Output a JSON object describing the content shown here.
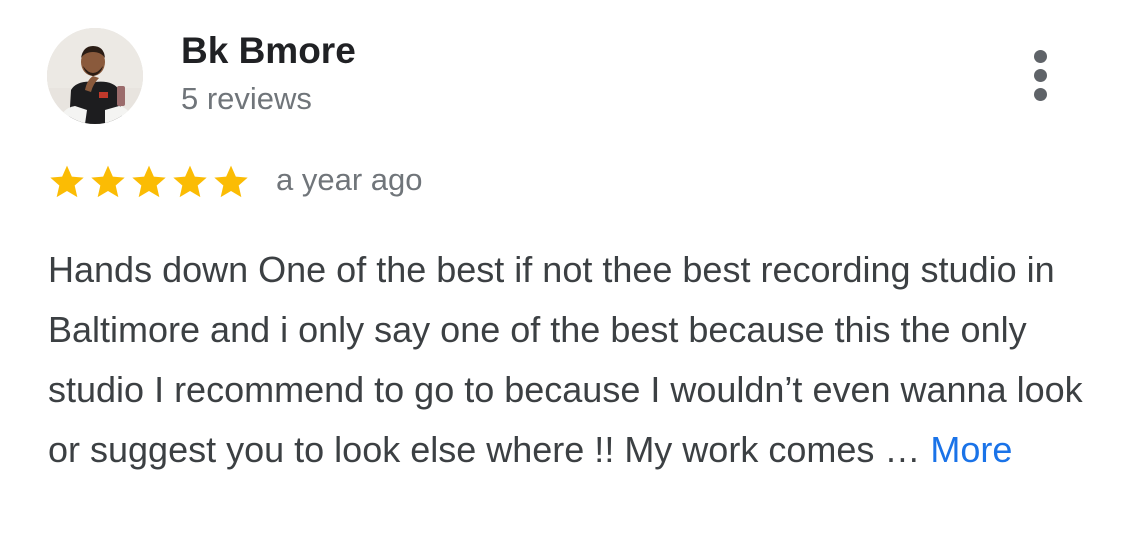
{
  "review": {
    "author": {
      "name": "Bk Bmore",
      "review_count": "5 reviews",
      "avatar_icon": "user-avatar-photo"
    },
    "rating": {
      "stars": 5,
      "max_stars": 5,
      "star_color": "#fbbc04"
    },
    "timestamp": "a year ago",
    "text": "Hands down One of the best if not thee best recording studio in Baltimore and i only say one of the best because this the only studio I recommend to go to because I wouldn’t even wanna look or suggest you to look else where !! My work comes …",
    "more_label": "More",
    "more_options_icon": "vertical-ellipsis-icon"
  },
  "colors": {
    "link": "#1a73e8",
    "secondary_text": "#70757a",
    "body_text": "#3c4043"
  }
}
